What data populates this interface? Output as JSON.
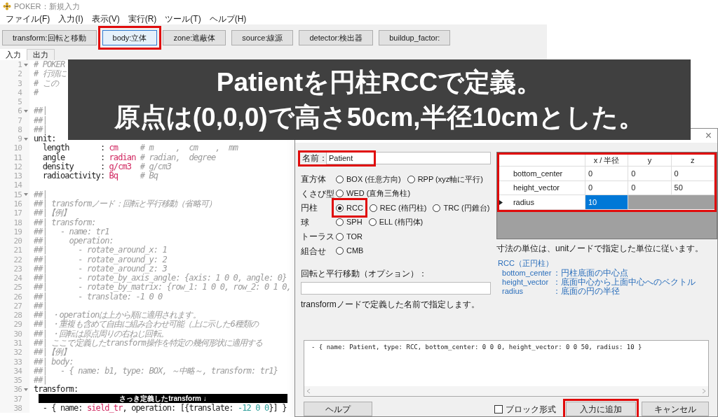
{
  "window": {
    "title": "POKER：新規入力"
  },
  "menu": [
    "ファイル(F)",
    "入力(I)",
    "表示(V)",
    "実行(R)",
    "ツール(T)",
    "ヘルプ(H)"
  ],
  "toolbar": [
    {
      "label": "transform:回転と移動",
      "highlighted": false
    },
    {
      "label": "body:立体",
      "highlighted": true
    },
    {
      "label": "zone:遮蔽体",
      "highlighted": false
    },
    {
      "label": "source:線源",
      "highlighted": false
    },
    {
      "label": "detector:検出器",
      "highlighted": false
    },
    {
      "label": "buildup_factor:",
      "highlighted": false
    }
  ],
  "tabs": [
    {
      "label": "入力",
      "selected": true
    },
    {
      "label": "出力",
      "selected": false
    }
  ],
  "editor": {
    "lines": [
      {
        "number": "1",
        "fold": true,
        "segments": [
          {
            "kind": "comment",
            "text": "# POKER"
          }
        ]
      },
      {
        "number": "2",
        "fold": false,
        "segments": [
          {
            "kind": "comment",
            "text": "# 行頭に"
          }
        ]
      },
      {
        "number": "3",
        "fold": false,
        "segments": [
          {
            "kind": "comment",
            "text": "# この"
          }
        ]
      },
      {
        "number": "4",
        "fold": false,
        "segments": [
          {
            "kind": "comment",
            "text": "#"
          }
        ]
      },
      {
        "number": "5",
        "fold": false
      },
      {
        "number": "6",
        "fold": true,
        "segments": [
          {
            "kind": "comment",
            "text": "##|"
          }
        ]
      },
      {
        "number": "7",
        "fold": false,
        "segments": [
          {
            "kind": "comment",
            "text": "##|"
          }
        ]
      },
      {
        "number": "8",
        "fold": false,
        "segments": [
          {
            "kind": "comment",
            "text": "##|"
          }
        ]
      },
      {
        "number": "9",
        "fold": true,
        "segments": [
          {
            "kind": "key",
            "text": "unit:"
          }
        ]
      },
      {
        "number": "10",
        "fold": false,
        "segments": [
          {
            "kind": "key",
            "text": "  length       "
          },
          {
            "kind": "plain",
            "text": ": "
          },
          {
            "kind": "value",
            "text": "cm"
          },
          {
            "kind": "comment",
            "text": "     # m     ,  cm    ,  mm"
          }
        ]
      },
      {
        "number": "11",
        "fold": false,
        "segments": [
          {
            "kind": "key",
            "text": "  angle        "
          },
          {
            "kind": "plain",
            "text": ": "
          },
          {
            "kind": "value",
            "text": "radian"
          },
          {
            "kind": "comment",
            "text": " # radian,  degree"
          }
        ]
      },
      {
        "number": "12",
        "fold": false,
        "segments": [
          {
            "kind": "key",
            "text": "  density      "
          },
          {
            "kind": "plain",
            "text": ": "
          },
          {
            "kind": "value",
            "text": "g/cm3"
          },
          {
            "kind": "comment",
            "text": "  # g/cm3"
          }
        ]
      },
      {
        "number": "13",
        "fold": false,
        "segments": [
          {
            "kind": "key",
            "text": "  radioactivity"
          },
          {
            "kind": "plain",
            "text": ": "
          },
          {
            "kind": "value",
            "text": "Bq"
          },
          {
            "kind": "comment",
            "text": "     # Bq"
          }
        ]
      },
      {
        "number": "14",
        "fold": false
      },
      {
        "number": "15",
        "fold": true,
        "segments": [
          {
            "kind": "comment",
            "text": "##|"
          }
        ]
      },
      {
        "number": "16",
        "fold": false,
        "segments": [
          {
            "kind": "comment",
            "text": "##| transformノード：回転と平行移動（省略可）"
          }
        ]
      },
      {
        "number": "17",
        "fold": false,
        "segments": [
          {
            "kind": "comment",
            "text": "##|【例】"
          }
        ]
      },
      {
        "number": "18",
        "fold": false,
        "segments": [
          {
            "kind": "comment",
            "text": "##| transform:"
          }
        ]
      },
      {
        "number": "19",
        "fold": false,
        "segments": [
          {
            "kind": "comment",
            "text": "##|   - name: tr1"
          }
        ]
      },
      {
        "number": "20",
        "fold": false,
        "segments": [
          {
            "kind": "comment",
            "text": "##|     operation:"
          }
        ]
      },
      {
        "number": "21",
        "fold": false,
        "segments": [
          {
            "kind": "comment",
            "text": "##|       - rotate_around_x: 1"
          }
        ]
      },
      {
        "number": "22",
        "fold": false,
        "segments": [
          {
            "kind": "comment",
            "text": "##|       - rotate_around_y: 2"
          }
        ]
      },
      {
        "number": "23",
        "fold": false,
        "segments": [
          {
            "kind": "comment",
            "text": "##|       - rotate_around_z: 3"
          }
        ]
      },
      {
        "number": "24",
        "fold": false,
        "segments": [
          {
            "kind": "comment",
            "text": "##|       - rotate_by_axis_angle: {axis: 1 0 0, angle: 0}"
          }
        ]
      },
      {
        "number": "25",
        "fold": false,
        "segments": [
          {
            "kind": "comment",
            "text": "##|       - rotate_by_matrix: {row_1: 1 0 0, row_2: 0 1 0,"
          }
        ]
      },
      {
        "number": "26",
        "fold": false,
        "segments": [
          {
            "kind": "comment",
            "text": "##|       - translate: -1 0 0"
          }
        ]
      },
      {
        "number": "27",
        "fold": false,
        "segments": [
          {
            "kind": "comment",
            "text": "##|"
          }
        ]
      },
      {
        "number": "28",
        "fold": false,
        "segments": [
          {
            "kind": "comment",
            "text": "##| ・operationは上から順に適用されます。"
          }
        ]
      },
      {
        "number": "29",
        "fold": false,
        "segments": [
          {
            "kind": "comment",
            "text": "##| ・重複も含めて自由に組み合わせ可能（上に示した6種類の"
          }
        ]
      },
      {
        "number": "30",
        "fold": false,
        "segments": [
          {
            "kind": "comment",
            "text": "##| ・回転は原点周りの右ねじ回転。"
          }
        ]
      },
      {
        "number": "31",
        "fold": false,
        "segments": [
          {
            "kind": "comment",
            "text": "##| ここで定義したtransform操作を特定の幾何形状に適用する"
          }
        ]
      },
      {
        "number": "32",
        "fold": false,
        "segments": [
          {
            "kind": "comment",
            "text": "##|【例】"
          }
        ]
      },
      {
        "number": "33",
        "fold": false,
        "segments": [
          {
            "kind": "comment",
            "text": "##| body:"
          }
        ]
      },
      {
        "number": "34",
        "fold": false,
        "segments": [
          {
            "kind": "comment",
            "text": "##|   - { name: b1, type: BOX, ～中略～, transform: tr1}"
          }
        ]
      },
      {
        "number": "35",
        "fold": false,
        "segments": [
          {
            "kind": "comment",
            "text": "##|"
          }
        ]
      },
      {
        "number": "36",
        "fold": true,
        "segments": [
          {
            "kind": "key",
            "text": "transform:"
          }
        ]
      },
      {
        "number": "37",
        "fold": false
      },
      {
        "number": "38",
        "fold": false,
        "segments": [
          {
            "kind": "plain",
            "text": "  - { name: "
          },
          {
            "kind": "value",
            "text": "sield_tr"
          },
          {
            "kind": "plain",
            "text": ", operation: [{translate: "
          },
          {
            "kind": "number",
            "text": "-12 0 0"
          },
          {
            "kind": "plain",
            "text": "}] }"
          }
        ]
      }
    ]
  },
  "annotation_label": "さっき定義したtransform ↓",
  "banner": {
    "lines": [
      "Patientを円柱RCCで定義。",
      "原点は(0,0,0)で高さ50cm,半径10cmとした。"
    ]
  },
  "dialog": {
    "close": "×",
    "name_field": {
      "label": "名前：",
      "value": "Patient",
      "highlighted": true
    },
    "shape_groups": [
      {
        "label": "直方体",
        "options": [
          {
            "label": "BOX (任意方向)",
            "selected": false,
            "highlighted": false
          },
          {
            "label": "RPP (xyz軸に平行)",
            "selected": false,
            "highlighted": false
          }
        ]
      },
      {
        "label": "くさび型",
        "options": [
          {
            "label": "WED (直角三角柱)",
            "selected": false,
            "highlighted": false
          }
        ]
      },
      {
        "label": "円柱",
        "options": [
          {
            "label": "RCC",
            "selected": true,
            "highlighted": true
          },
          {
            "label": "REC (楕円柱)",
            "selected": false,
            "highlighted": false
          },
          {
            "label": "TRC (円錐台)",
            "selected": false,
            "highlighted": false
          }
        ]
      },
      {
        "label": "球",
        "options": [
          {
            "label": "SPH",
            "selected": false,
            "highlighted": false
          },
          {
            "label": "ELL (楕円体)",
            "selected": false,
            "highlighted": false
          }
        ]
      },
      {
        "label": "トーラス",
        "options": [
          {
            "label": "TOR",
            "selected": false,
            "highlighted": false
          }
        ]
      },
      {
        "label": "組合せ",
        "options": [
          {
            "label": "CMB",
            "selected": false,
            "highlighted": false
          }
        ]
      }
    ],
    "transform_field": {
      "label": "回転と平行移動（オプション）：",
      "note": "transformノードで定義した名前で指定します。"
    },
    "table": {
      "highlighted": true,
      "columns": [
        "x / 半径",
        "y",
        "z"
      ],
      "rows": [
        {
          "label": "bottom_center",
          "cells": [
            "0",
            "0",
            "0"
          ],
          "current": false
        },
        {
          "label": "height_vector",
          "cells": [
            "0",
            "0",
            "50"
          ],
          "current": false
        },
        {
          "label": "radius",
          "cells": [
            "10"
          ],
          "current": true
        }
      ]
    },
    "unit_note": "寸法の単位は、unitノードで指定した単位に従います。",
    "help": {
      "title": "RCC（正円柱）",
      "items": [
        {
          "term": "bottom_center",
          "desc": "：円柱底面の中心点"
        },
        {
          "term": "height_vector",
          "desc": "：底面中心から上面中心へのベクトル"
        },
        {
          "term": "radius",
          "desc": "：底面の円の半径"
        }
      ]
    },
    "preview": "- { name: Patient, type: RCC, bottom_center: 0 0 0, height_vector: 0 0 50, radius: 10 }",
    "help_button": {
      "label": "ヘルプ"
    },
    "block_format": {
      "label": "ブロック形式",
      "checked": false
    },
    "add_button": {
      "label": "入力に追加",
      "highlighted": true
    },
    "cancel_button": {
      "label": "キャンセル"
    }
  }
}
